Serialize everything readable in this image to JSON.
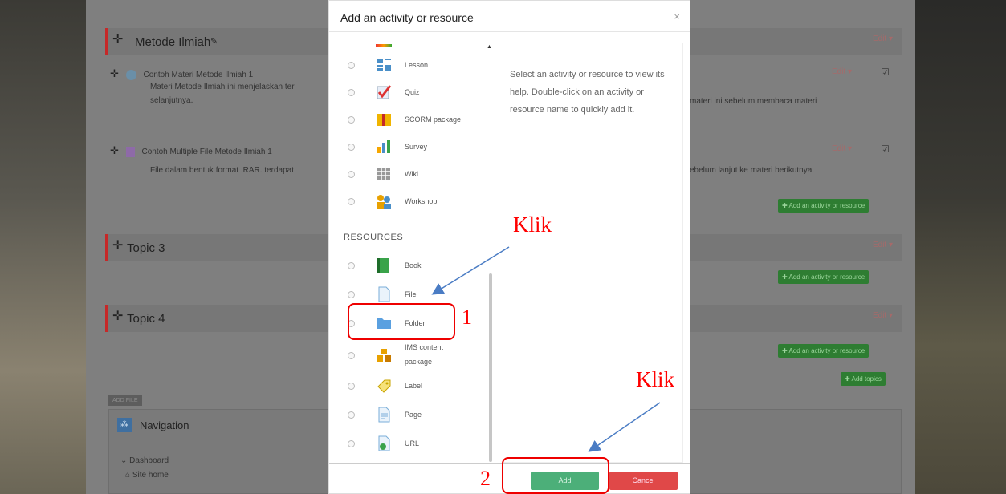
{
  "modal": {
    "title": "Add an activity or resource",
    "close": "×",
    "activities_top": [
      {
        "label": "Lesson",
        "icon": "lesson-icon"
      },
      {
        "label": "Quiz",
        "icon": "quiz-icon"
      },
      {
        "label": "SCORM package",
        "icon": "scorm-package-icon"
      },
      {
        "label": "Survey",
        "icon": "survey-icon"
      },
      {
        "label": "Wiki",
        "icon": "wiki-icon"
      },
      {
        "label": "Workshop",
        "icon": "workshop-icon"
      }
    ],
    "resources_heading": "RESOURCES",
    "resources": [
      {
        "label": "Book",
        "icon": "book-icon"
      },
      {
        "label": "File",
        "icon": "file-icon"
      },
      {
        "label": "Folder",
        "icon": "folder-icon"
      },
      {
        "label": "IMS content package",
        "line1": "IMS content",
        "line2": "package",
        "icon": "ims-package-icon"
      },
      {
        "label": "Label",
        "icon": "label-icon"
      },
      {
        "label": "Page",
        "icon": "page-icon"
      },
      {
        "label": "URL",
        "icon": "url-icon"
      }
    ],
    "help_text": "Select an activity or resource to view its help. Double-click on an activity or resource name to quickly add it.",
    "add_label": "Add",
    "cancel_label": "Cancel"
  },
  "background": {
    "section1_title": "Metode Ilmiah",
    "item1_title": "Contoh Materi Metode Ilmiah 1",
    "item1_desc_left": "Materi Metode Ilmiah ini menjelaskan ter",
    "item1_desc_left2": "selanjutnya.",
    "item1_desc_right": "materi ini sebelum membaca materi",
    "item2_title": "Contoh Multiple File Metode Ilmiah 1",
    "item2_desc_left": "File dalam bentuk format .RAR. terdapat",
    "item2_desc_right": "ebelum lanjut ke materi berikutnya.",
    "edit_label": "Edit ▾",
    "add_activity_label": "✚ Add an activity or resource",
    "topic3": "Topic 3",
    "topic4": "Topic 4",
    "add_topics_label": "✚ Add topics",
    "nav_tag": "ADD FILE",
    "nav_title": "Navigation",
    "nav_dashboard": "Dashboard",
    "nav_site_home": "Site home"
  },
  "annotations": {
    "klik1": "Klik",
    "klik2": "Klik",
    "num1": "1",
    "num2": "2"
  },
  "colors": {
    "add_button": "#4caf79",
    "cancel_button": "#e04848",
    "annotation": "#ff0000",
    "arrow": "#4a7cc4"
  }
}
